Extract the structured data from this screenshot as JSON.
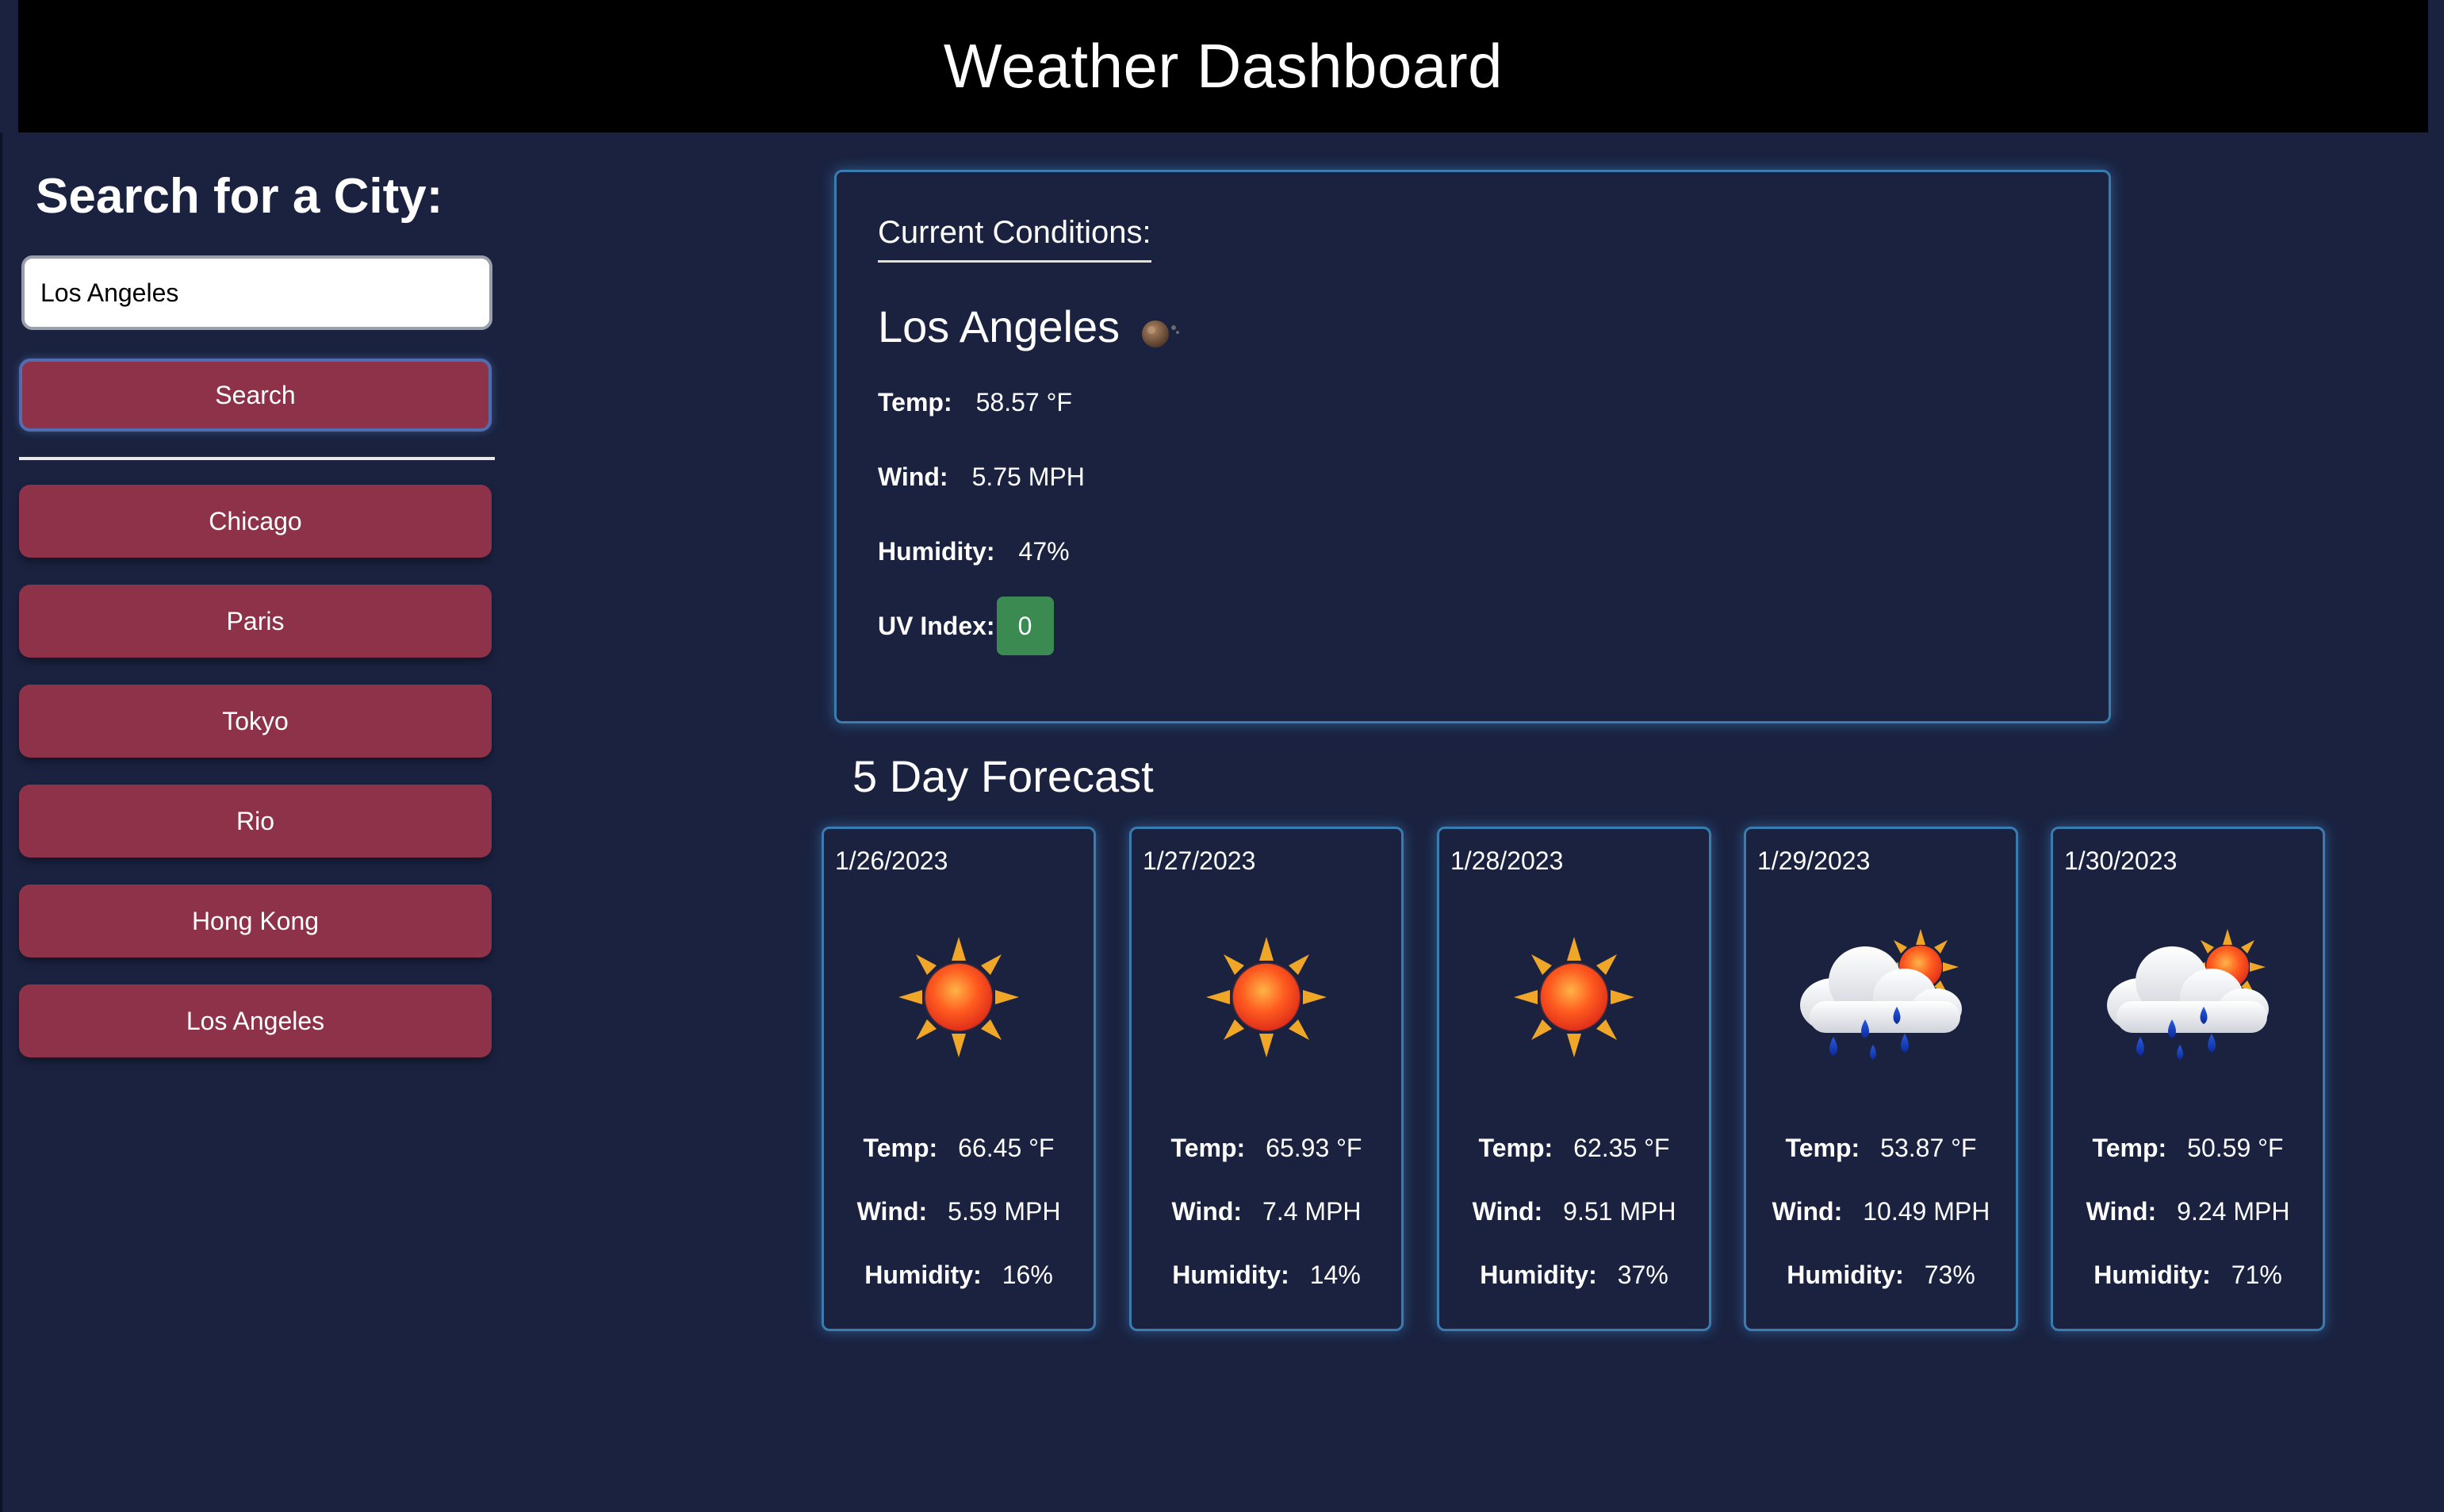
{
  "header": {
    "title": "Weather Dashboard"
  },
  "sidebar": {
    "title": "Search for a City:",
    "input_value": "Los Angeles",
    "search_label": "Search",
    "history": [
      "Chicago",
      "Paris",
      "Tokyo",
      "Rio",
      "Hong Kong",
      "Los Angeles"
    ]
  },
  "current": {
    "label": "Current Conditions:",
    "city": "Los Angeles",
    "icon": "moon-icon",
    "temp_label": "Temp:",
    "temp": "58.57 °F",
    "wind_label": "Wind:",
    "wind": "5.75 MPH",
    "humidity_label": "Humidity:",
    "humidity": "47%",
    "uv_label": "UV Index:",
    "uv": "0",
    "uv_color": "#3a8a52"
  },
  "forecast": {
    "title": "5 Day Forecast",
    "temp_label": "Temp:",
    "wind_label": "Wind:",
    "humidity_label": "Humidity:",
    "days": [
      {
        "date": "1/26/2023",
        "icon": "sun-icon",
        "temp": "66.45 °F",
        "wind": "5.59 MPH",
        "humidity": "16%"
      },
      {
        "date": "1/27/2023",
        "icon": "sun-icon",
        "temp": "65.93 °F",
        "wind": "7.4 MPH",
        "humidity": "14%"
      },
      {
        "date": "1/28/2023",
        "icon": "sun-icon",
        "temp": "62.35 °F",
        "wind": "9.51 MPH",
        "humidity": "37%"
      },
      {
        "date": "1/29/2023",
        "icon": "rain-sun-icon",
        "temp": "53.87 °F",
        "wind": "10.49 MPH",
        "humidity": "73%"
      },
      {
        "date": "1/30/2023",
        "icon": "rain-sun-icon",
        "temp": "50.59 °F",
        "wind": "9.24 MPH",
        "humidity": "71%"
      }
    ]
  },
  "colors": {
    "background": "#1a2240",
    "header": "#000000",
    "button": "#8e324a",
    "card_border": "#3a7cb0"
  }
}
